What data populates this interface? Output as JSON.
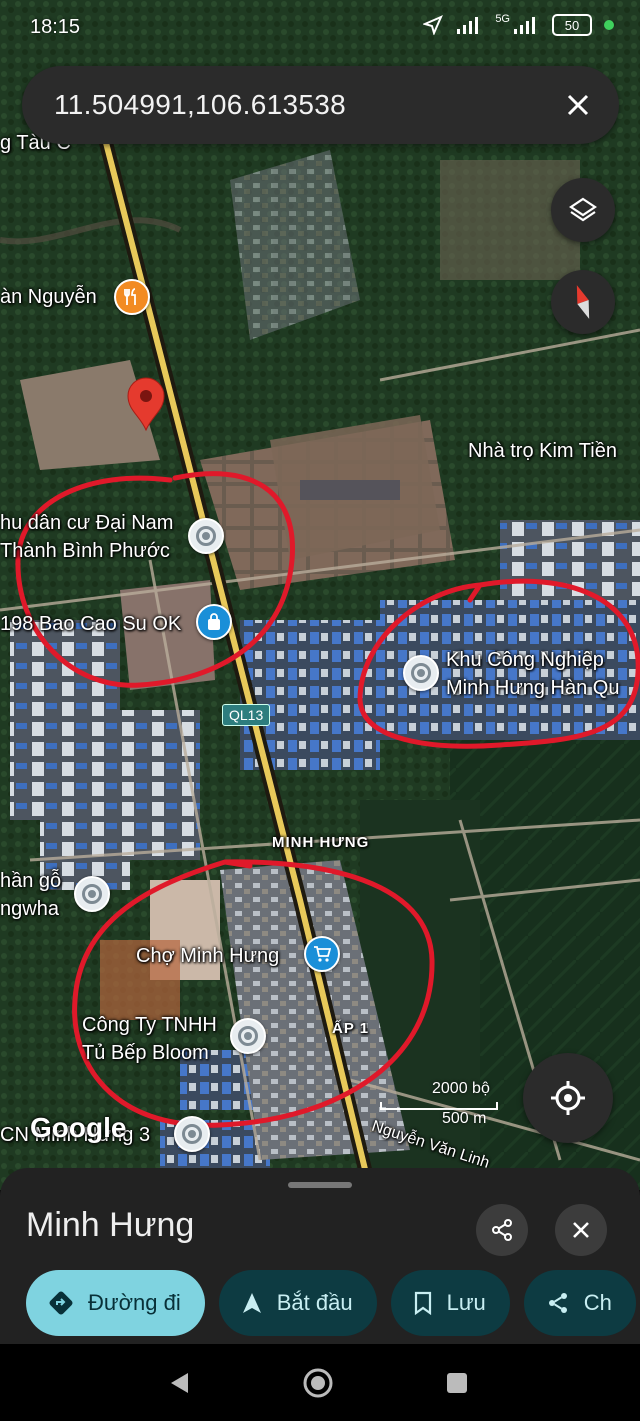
{
  "status_bar": {
    "time": "18:15",
    "network": "5G",
    "battery": "50"
  },
  "search": {
    "query": "11.504991,106.613538"
  },
  "map_labels": {
    "top_left": "g Tàu C",
    "restaurant": "àn Nguyễn",
    "motel": "Nhà trọ Kim Tiền",
    "residential_line1": "hu dân cư Đại Nam",
    "residential_line2": "Thành Bình Phước",
    "condom_shop": "198 Bao Cao Su OK",
    "industrial_line1": "Khu Công Nghiệp",
    "industrial_line2": "Minh Hưng Hàn Qu",
    "highway": "QL13",
    "area": "MINH HƯNG",
    "wood_line1": "hần gỗ",
    "wood_line2": "ngwha",
    "market": "Chợ Minh Hưng",
    "company_line1": "Công Ty TNHH",
    "company_line2": "Tủ Bếp Bloom",
    "hamlet": "ẤP 1",
    "street": "Nguyễn Văn Linh",
    "bottom_left": "CN Minh Hưng 3"
  },
  "map_ui": {
    "google": "Google",
    "scale_ft": "2000 bộ",
    "scale_m": "500 m",
    "layers_icon": "layers-icon",
    "compass_icon": "compass-icon",
    "location_icon": "my-location-icon"
  },
  "sheet": {
    "place_name": "Minh Hưng",
    "chips": [
      {
        "label": "Đường đi",
        "icon": "directions-icon"
      },
      {
        "label": "Bắt đầu",
        "icon": "navigation-arrow-icon"
      },
      {
        "label": "Lưu",
        "icon": "bookmark-icon"
      },
      {
        "label": "Ch",
        "icon": "share-icon"
      }
    ]
  },
  "colors": {
    "annotation_circle": "#e0192a",
    "primary_chip": "#7fd3e0",
    "secondary_chip": "#0d3b42",
    "road": "#e8c95a"
  }
}
